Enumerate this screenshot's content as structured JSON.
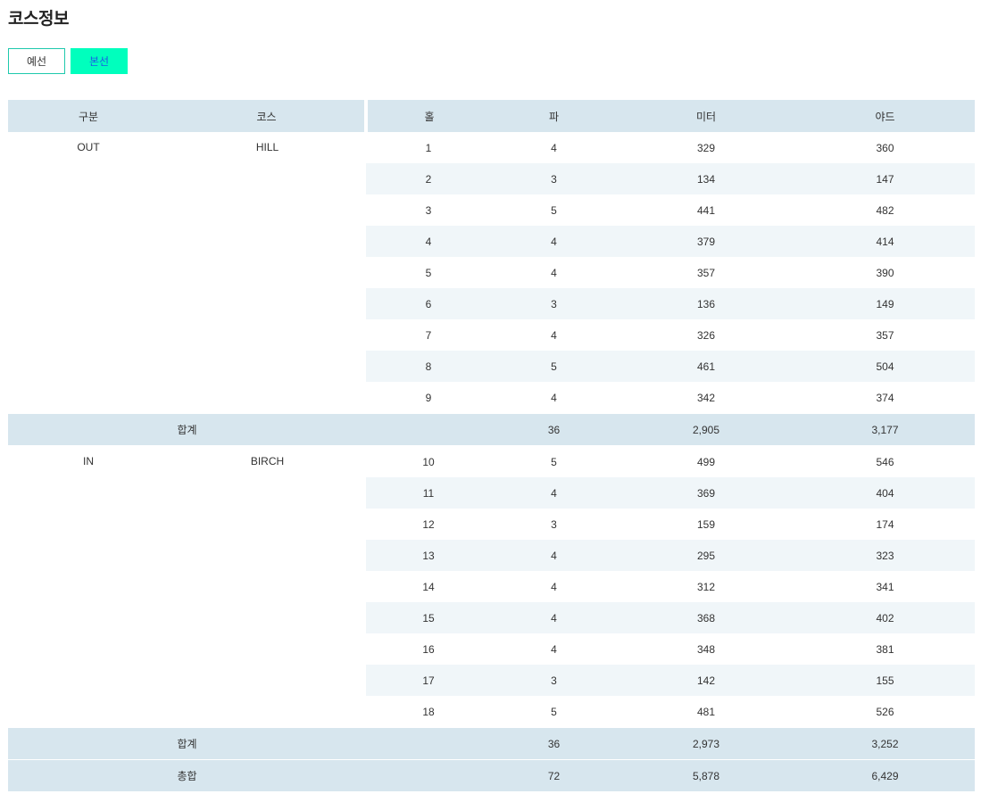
{
  "page": {
    "title": "코스정보"
  },
  "tabs": [
    {
      "label": "예선",
      "active": false
    },
    {
      "label": "본선",
      "active": true
    }
  ],
  "colors": {
    "header_bg": "#d7e6ee",
    "alt_row_bg": "#f0f6f9",
    "active_tab_bg": "#00ffbd",
    "active_tab_text": "#1a5de6",
    "tab_border": "#1fc9ad"
  },
  "table": {
    "headers": [
      "구분",
      "코스",
      "홀",
      "파",
      "미터",
      "야드"
    ],
    "sections": [
      {
        "division": "OUT",
        "course": "HILL",
        "rows": [
          [
            "1",
            "4",
            "329",
            "360"
          ],
          [
            "2",
            "3",
            "134",
            "147"
          ],
          [
            "3",
            "5",
            "441",
            "482"
          ],
          [
            "4",
            "4",
            "379",
            "414"
          ],
          [
            "5",
            "4",
            "357",
            "390"
          ],
          [
            "6",
            "3",
            "136",
            "149"
          ],
          [
            "7",
            "4",
            "326",
            "357"
          ],
          [
            "8",
            "5",
            "461",
            "504"
          ],
          [
            "9",
            "4",
            "342",
            "374"
          ]
        ],
        "subtotal": {
          "label": "합계",
          "par": "36",
          "meter": "2,905",
          "yard": "3,177"
        }
      },
      {
        "division": "IN",
        "course": "BIRCH",
        "rows": [
          [
            "10",
            "5",
            "499",
            "546"
          ],
          [
            "11",
            "4",
            "369",
            "404"
          ],
          [
            "12",
            "3",
            "159",
            "174"
          ],
          [
            "13",
            "4",
            "295",
            "323"
          ],
          [
            "14",
            "4",
            "312",
            "341"
          ],
          [
            "15",
            "4",
            "368",
            "402"
          ],
          [
            "16",
            "4",
            "348",
            "381"
          ],
          [
            "17",
            "3",
            "142",
            "155"
          ],
          [
            "18",
            "5",
            "481",
            "526"
          ]
        ],
        "subtotal": {
          "label": "합계",
          "par": "36",
          "meter": "2,973",
          "yard": "3,252"
        }
      }
    ],
    "total": {
      "label": "총합",
      "par": "72",
      "meter": "5,878",
      "yard": "6,429"
    }
  }
}
